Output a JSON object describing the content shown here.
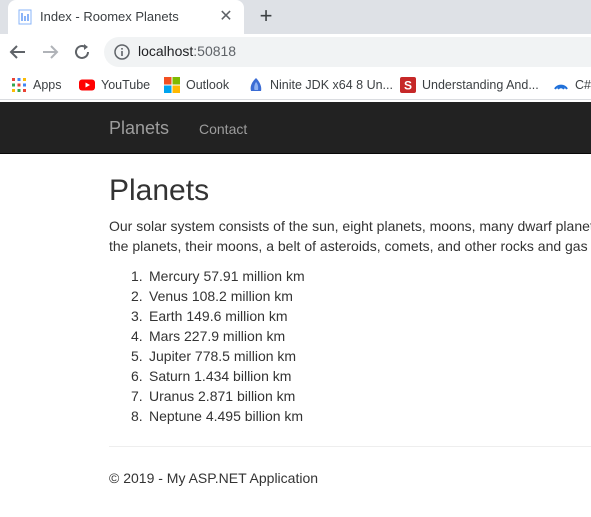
{
  "browser": {
    "tab": {
      "title": "Index - Roomex Planets"
    },
    "url": {
      "host": "localhost",
      "port": ":50818"
    }
  },
  "bookmarks": [
    {
      "label": "Apps",
      "icon": "apps-grid-icon"
    },
    {
      "label": "YouTube",
      "icon": "youtube-icon"
    },
    {
      "label": "Outlook",
      "icon": "office-icon"
    },
    {
      "label": "Ninite JDK x64 8 Un...",
      "icon": "ninite-icon"
    },
    {
      "label": "Understanding And...",
      "icon": "bookmark-s-icon"
    },
    {
      "label": "C#",
      "icon": "globe-icon"
    }
  ],
  "navbar": {
    "brand": "Planets",
    "contact": "Contact"
  },
  "page": {
    "heading": "Planets",
    "intro_line1": "Our solar system consists of the sun, eight planets, moons, many dwarf planets",
    "intro_line2": "the planets, their moons, a belt of asteroids, comets, and other rocks and gas"
  },
  "planets": [
    {
      "num": "1.",
      "text": "Mercury 57.91 million km"
    },
    {
      "num": "2.",
      "text": "Venus 108.2 million km"
    },
    {
      "num": "3.",
      "text": "Earth 149.6 million km"
    },
    {
      "num": "4.",
      "text": "Mars 227.9 million km"
    },
    {
      "num": "5.",
      "text": "Jupiter 778.5 million km"
    },
    {
      "num": "6.",
      "text": "Saturn 1.434 billion km"
    },
    {
      "num": "7.",
      "text": "Uranus 2.871 billion km"
    },
    {
      "num": "8.",
      "text": "Neptune 4.495 billion km"
    }
  ],
  "footer": {
    "text": "© 2019 - My ASP.NET Application"
  },
  "colors": {
    "navbar": "#222222",
    "nav_text": "#9d9d9d",
    "text": "#333333",
    "chrome": "#dee1e6"
  }
}
